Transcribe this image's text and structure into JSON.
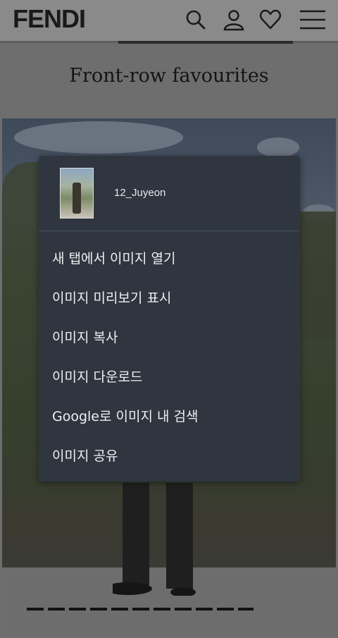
{
  "header": {
    "logo": "FENDI",
    "icons": [
      "search-icon",
      "account-icon",
      "wishlist-heart-icon",
      "menu-hamburger-icon"
    ]
  },
  "section": {
    "title": "Front-row favourites"
  },
  "context_menu": {
    "image_name": "12_Juyeon",
    "items": [
      {
        "label": "새 탭에서 이미지 열기"
      },
      {
        "label": "이미지 미리보기 표시"
      },
      {
        "label": "이미지 복사"
      },
      {
        "label": "이미지 다운로드"
      },
      {
        "label": "Google로 이미지 내 검색"
      },
      {
        "label": "이미지 공유"
      }
    ]
  },
  "colors": {
    "menu_bg": "#2f3640",
    "menu_text": "#eef0f2",
    "page_overlay": "#6e6e6e"
  }
}
